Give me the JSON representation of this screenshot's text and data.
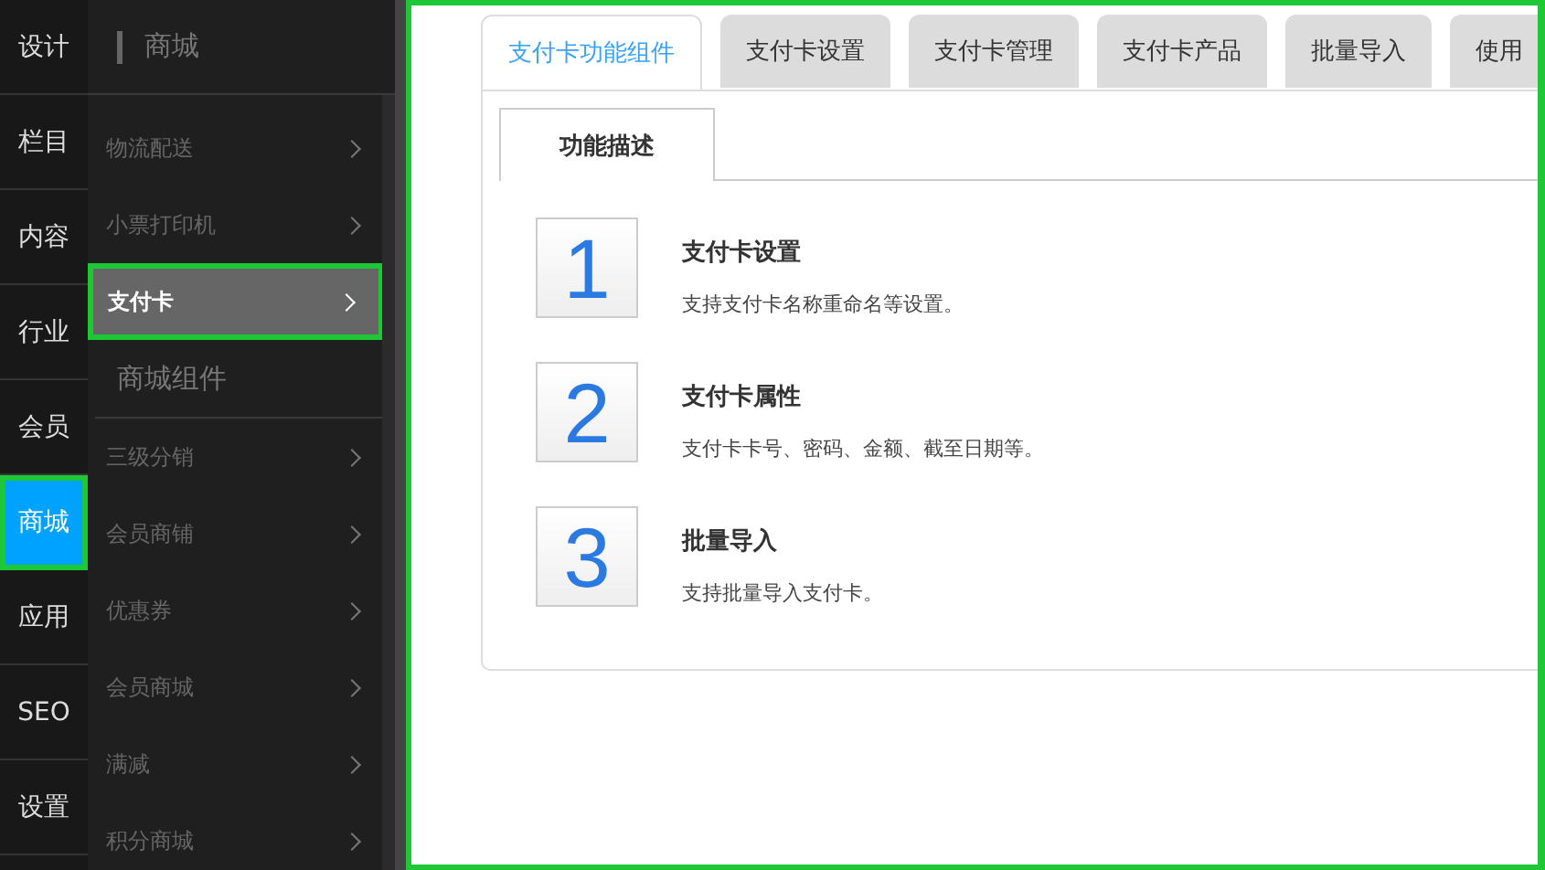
{
  "nav": [
    {
      "label": "设计",
      "selected": false
    },
    {
      "label": "栏目",
      "selected": false
    },
    {
      "label": "内容",
      "selected": false
    },
    {
      "label": "行业",
      "selected": false
    },
    {
      "label": "会员",
      "selected": false
    },
    {
      "label": "商城",
      "selected": true
    },
    {
      "label": "应用",
      "selected": false
    },
    {
      "label": "SEO",
      "selected": false
    },
    {
      "label": "设置",
      "selected": false
    }
  ],
  "submenu": {
    "title": "商城",
    "items": [
      {
        "kind": "item",
        "label": "物流配送",
        "selected": false
      },
      {
        "kind": "item",
        "label": "小票打印机",
        "selected": false
      },
      {
        "kind": "item",
        "label": "支付卡",
        "selected": true
      },
      {
        "kind": "group",
        "label": "商城组件"
      },
      {
        "kind": "item",
        "label": "三级分销",
        "selected": false
      },
      {
        "kind": "item",
        "label": "会员商铺",
        "selected": false
      },
      {
        "kind": "item",
        "label": "优惠券",
        "selected": false
      },
      {
        "kind": "item",
        "label": "会员商城",
        "selected": false
      },
      {
        "kind": "item",
        "label": "满减",
        "selected": false
      },
      {
        "kind": "item",
        "label": "积分商城",
        "selected": false
      }
    ]
  },
  "tabs": [
    {
      "label": "支付卡功能组件",
      "selected": true
    },
    {
      "label": "支付卡设置",
      "selected": false
    },
    {
      "label": "支付卡管理",
      "selected": false
    },
    {
      "label": "支付卡产品",
      "selected": false
    },
    {
      "label": "批量导入",
      "selected": false
    },
    {
      "label": "使用",
      "selected": false
    }
  ],
  "subtabs": [
    {
      "label": "功能描述",
      "selected": true
    }
  ],
  "features": [
    {
      "number": "1",
      "title": "支付卡设置",
      "description": "支持支付卡名称重命名等设置。"
    },
    {
      "number": "2",
      "title": "支付卡属性",
      "description": "支付卡卡号、密码、金额、截至日期等。"
    },
    {
      "number": "3",
      "title": "批量导入",
      "description": "支持批量导入支付卡。"
    }
  ]
}
